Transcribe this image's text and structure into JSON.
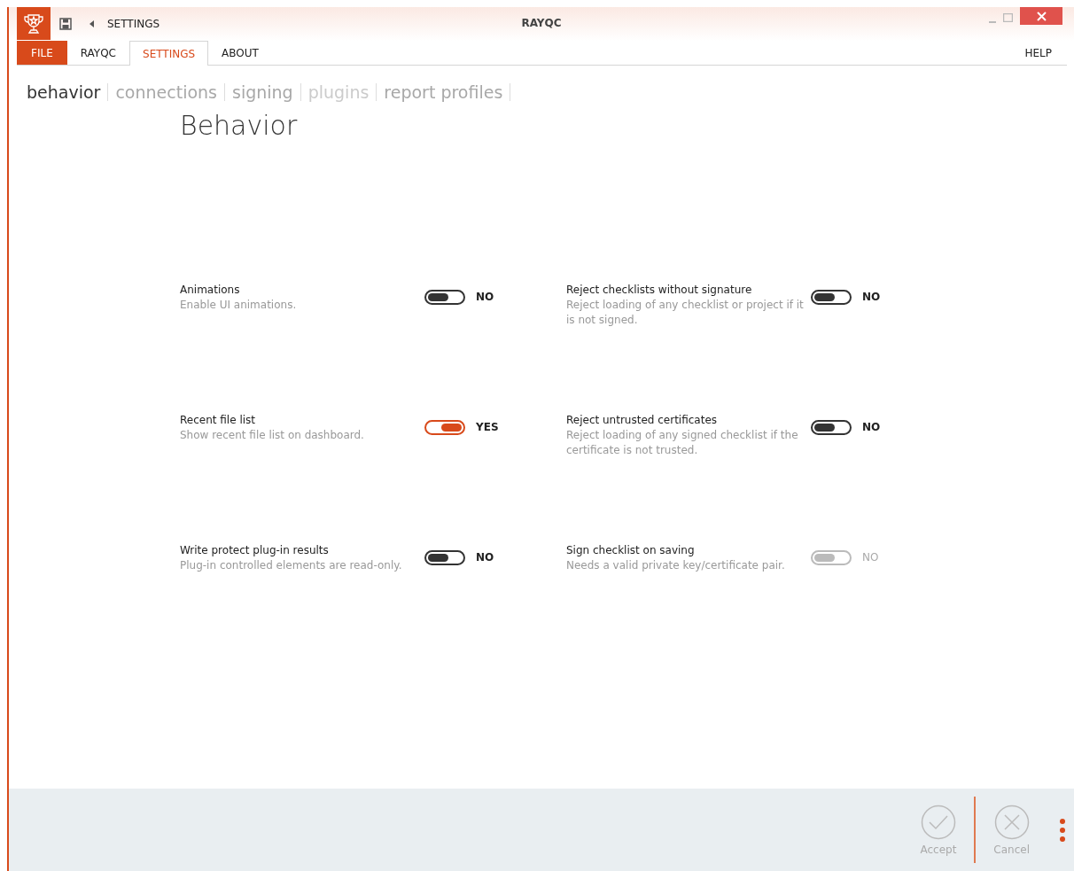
{
  "window": {
    "title": "RAYQC",
    "breadcrumb": "SETTINGS"
  },
  "tabs": [
    {
      "label": "FILE",
      "kind": "file",
      "selected": false
    },
    {
      "label": "RAYQC",
      "kind": "tab",
      "selected": false
    },
    {
      "label": "SETTINGS",
      "kind": "tab",
      "selected": true
    },
    {
      "label": "ABOUT",
      "kind": "tab",
      "selected": false
    }
  ],
  "help": "HELP",
  "subnav": [
    {
      "label": "behavior",
      "selected": true,
      "disabled": false
    },
    {
      "label": "connections",
      "selected": false,
      "disabled": false
    },
    {
      "label": "signing",
      "selected": false,
      "disabled": false
    },
    {
      "label": "plugins",
      "selected": false,
      "disabled": true
    },
    {
      "label": "report profiles",
      "selected": false,
      "disabled": false
    }
  ],
  "heading": "Behavior",
  "settings": [
    {
      "title": "Animations",
      "description": "Enable UI animations.",
      "on": false,
      "disabled": false,
      "value": "NO"
    },
    {
      "title": "Reject checklists without signature",
      "description": "Reject loading of any checklist or project if it is not signed.",
      "on": false,
      "disabled": false,
      "value": "NO"
    },
    {
      "title": "Recent file list",
      "description": "Show recent file list on dashboard.",
      "on": true,
      "disabled": false,
      "value": "YES"
    },
    {
      "title": "Reject untrusted certificates",
      "description": "Reject loading of any signed checklist if the certificate is not trusted.",
      "on": false,
      "disabled": false,
      "value": "NO"
    },
    {
      "title": "Write protect plug-in results",
      "description": "Plug-in controlled elements are read-only.",
      "on": false,
      "disabled": false,
      "value": "NO"
    },
    {
      "title": "Sign checklist on saving",
      "description": "Needs a valid private key/certificate pair.",
      "on": false,
      "disabled": true,
      "value": "NO"
    }
  ],
  "footer": [
    {
      "label": "Accept",
      "kind": "accept",
      "disabled": true
    },
    {
      "label": "Cancel",
      "kind": "cancel",
      "disabled": true
    }
  ]
}
